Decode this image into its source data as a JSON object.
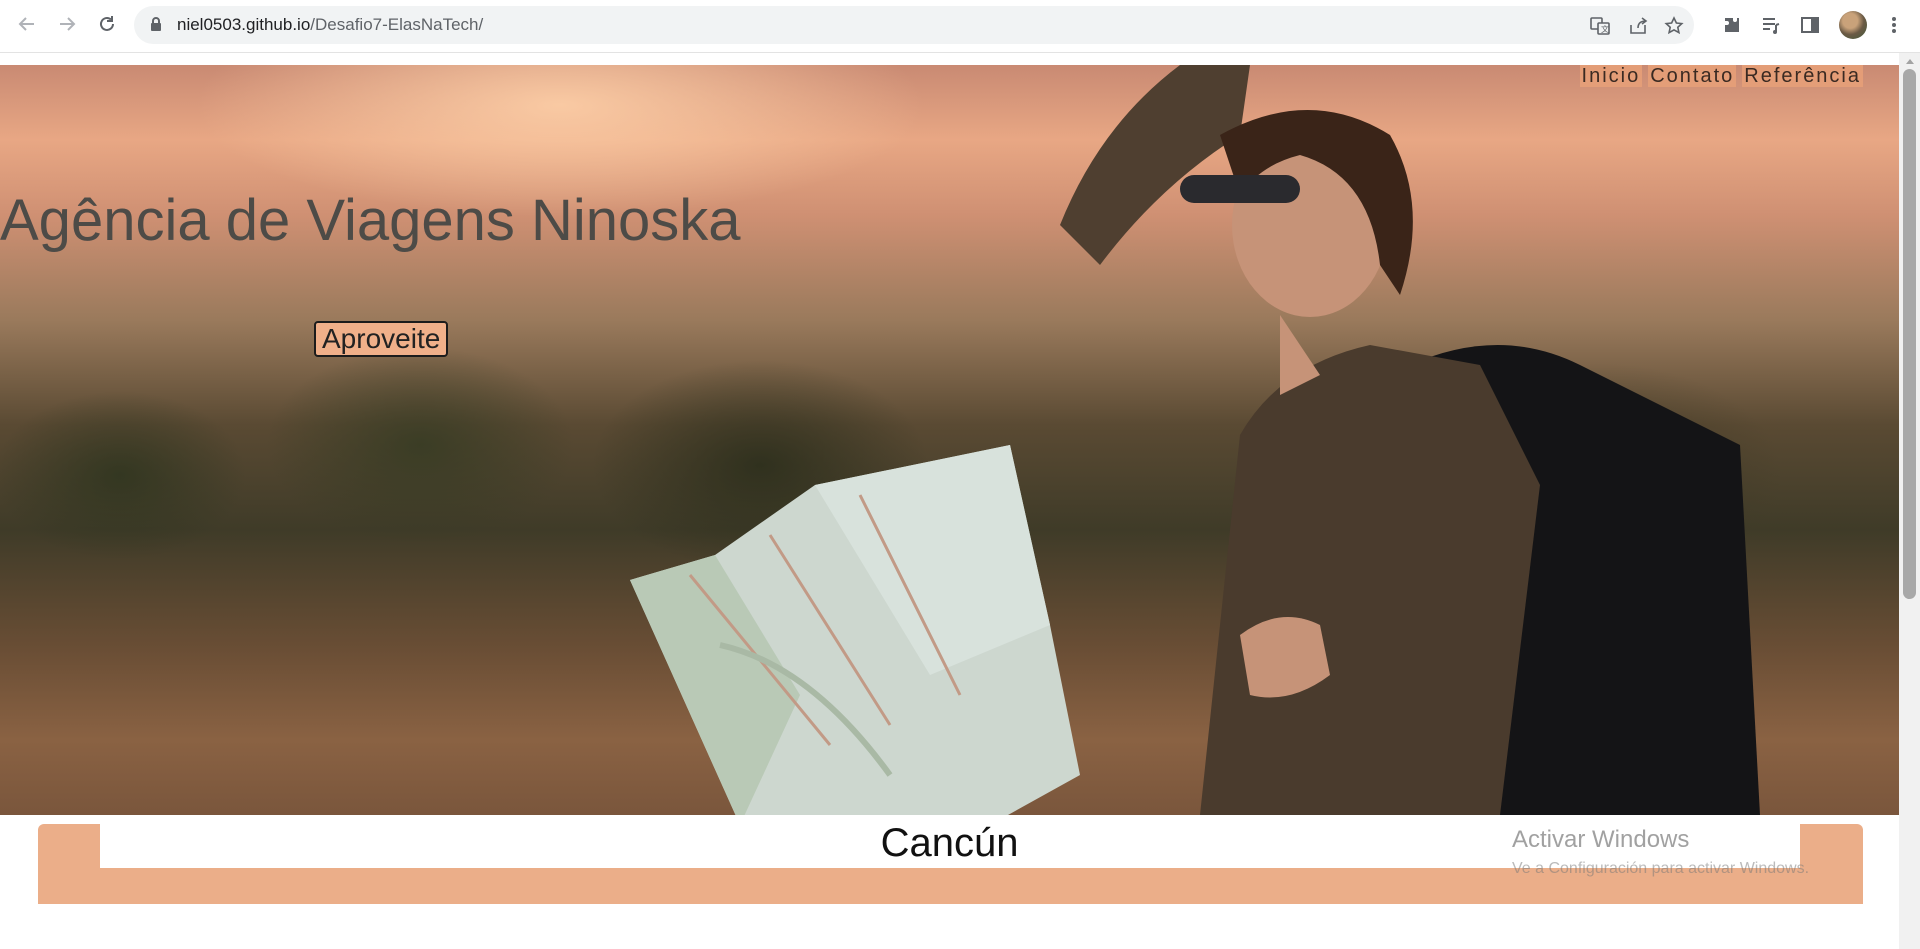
{
  "browser": {
    "url_host": "niel0503.github.io",
    "url_path": "/Desafio7-ElasNaTech/"
  },
  "page": {
    "nav": [
      "Inicio",
      "Contato",
      "Referência"
    ],
    "hero_title": "Agência de Viagens Ninoska",
    "cta_label": "Aproveite",
    "section_title": "Cancún"
  },
  "watermark": {
    "title": "Activar Windows",
    "subtitle": "Ve a Configuración para activar Windows."
  },
  "colors": {
    "accent": "#ebae89",
    "button_bg": "#f0b08a"
  }
}
